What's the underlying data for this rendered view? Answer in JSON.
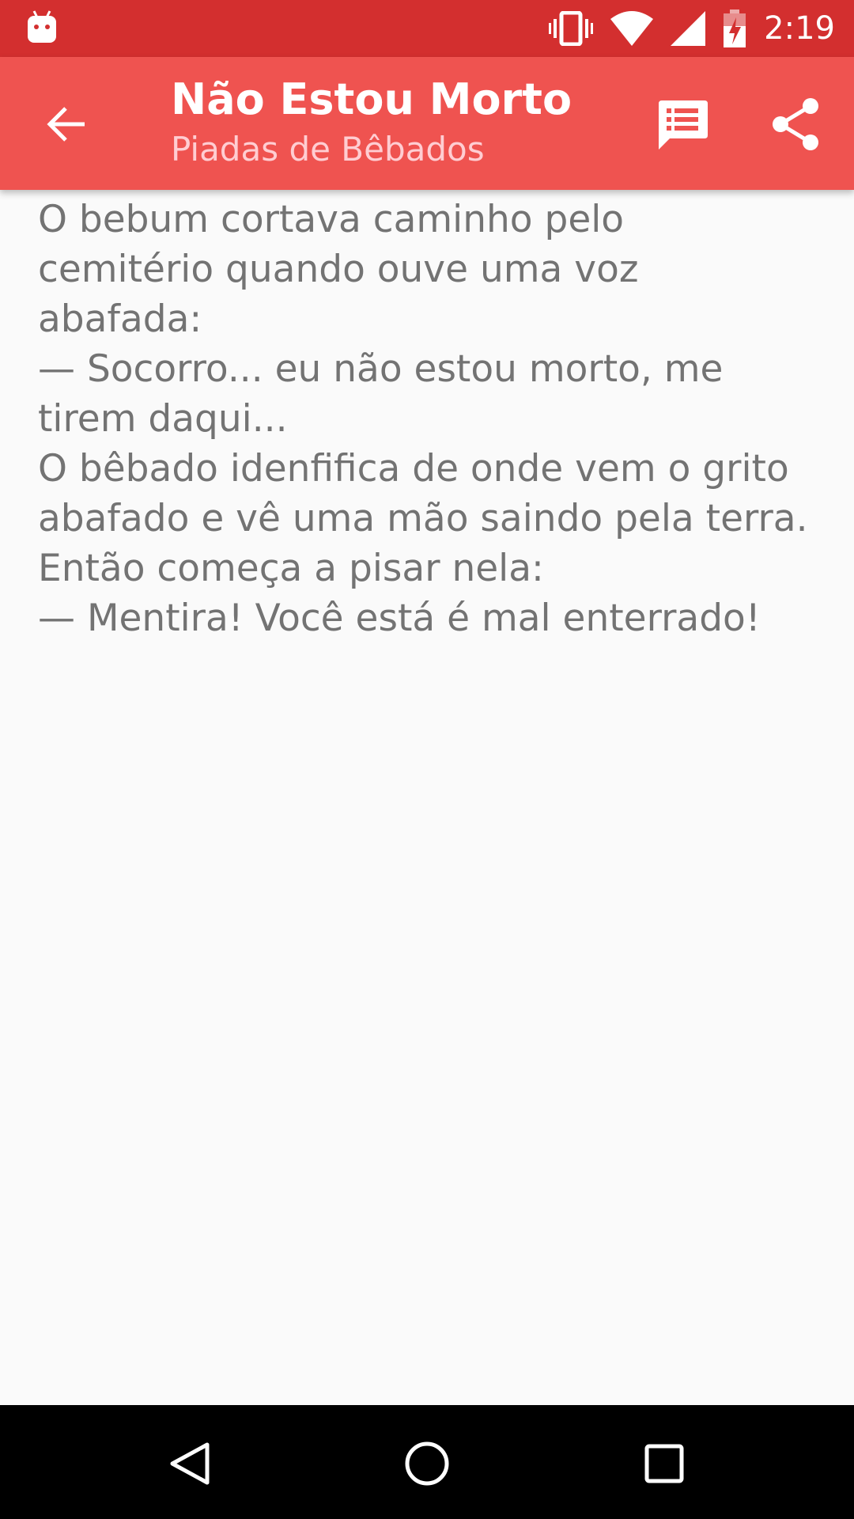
{
  "status_bar": {
    "time": "2:19",
    "icons": [
      "android-debug-icon",
      "vibrate-icon",
      "wifi-icon",
      "signal-icon",
      "battery-charging-icon"
    ],
    "background_color": "#d32f2f"
  },
  "app_bar": {
    "title": "Não Estou Morto",
    "subtitle": "Piadas de Bêbados",
    "background_color": "#ef5350",
    "nav_icon": "arrow-back-icon",
    "actions": [
      "message-list-icon",
      "share-icon"
    ]
  },
  "content": {
    "lines": [
      "O bebum cortava caminho pelo",
      "cemitério quando ouve uma voz",
      "abafada:",
      "— Socorro... eu não estou morto, me",
      "tirem daqui...",
      "O bêbado idenfifica de onde vem o grito",
      "abafado e vê uma mão saindo pela terra.",
      "Então começa a pisar nela:",
      "— Mentira! Você está é mal enterrado!"
    ]
  },
  "nav_bar": {
    "icons": [
      "nav-back-icon",
      "nav-home-icon",
      "nav-recents-icon"
    ]
  }
}
